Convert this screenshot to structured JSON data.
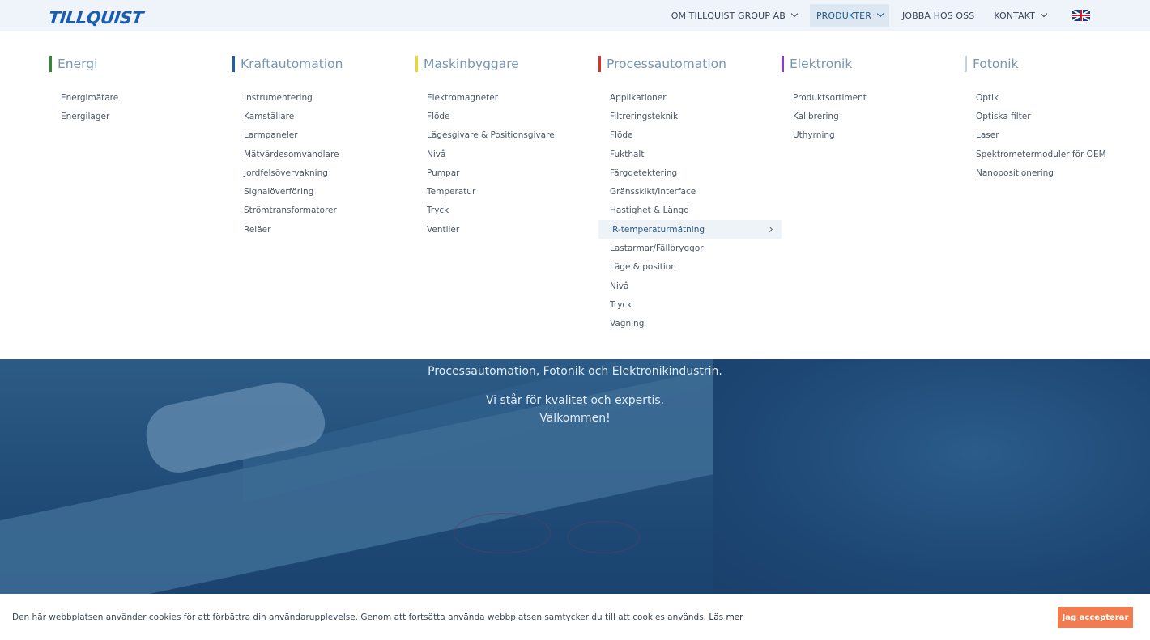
{
  "logo": {
    "text": "TILLQUIST"
  },
  "nav": {
    "items": [
      {
        "label": "OM TILLQUIST GROUP AB",
        "has_dropdown": true,
        "active": false
      },
      {
        "label": "PRODUKTER",
        "has_dropdown": true,
        "active": true
      },
      {
        "label": "JOBBA HOS OSS",
        "has_dropdown": false,
        "active": false
      },
      {
        "label": "KONTAKT",
        "has_dropdown": true,
        "active": false
      }
    ],
    "language_flag": "uk-flag-icon"
  },
  "mega_menu": {
    "columns": [
      {
        "title": "Energi",
        "accent": "#2e8b3a",
        "items": [
          "Energimätare",
          "Energilager"
        ]
      },
      {
        "title": "Kraftautomation",
        "accent": "#1f5fa8",
        "items": [
          "Instrumentering",
          "Kamställare",
          "Larmpaneler",
          "Mätvärdesomvandlare",
          "Jordfelsövervakning",
          "Signalöverföring",
          "Strömtransformatorer",
          "Reläer"
        ]
      },
      {
        "title": "Maskinbyggare",
        "accent": "#f2d42a",
        "items": [
          "Elektromagneter",
          "Flöde",
          "Lägesgivare & Positionsgivare",
          "Nivå",
          "Pumpar",
          "Temperatur",
          "Tryck",
          "Ventiler"
        ]
      },
      {
        "title": "Processautomation",
        "accent": "#d8312b",
        "items": [
          "Applikationer",
          "Filtreringsteknik",
          "Flöde",
          "Fukthalt",
          "Färgdetektering",
          "Gränsskikt/Interface",
          "Hastighet & Längd",
          "IR-temperaturmätning",
          "Lastarmar/Fällbryggor",
          "Läge & position",
          "Nivå",
          "Tryck",
          "Vägning"
        ],
        "highlighted_index": 7
      },
      {
        "title": "Elektronik",
        "accent": "#8a3fc4",
        "items": [
          "Produktsortiment",
          "Kalibrering",
          "Uthyrning"
        ]
      },
      {
        "title": "Fotonik",
        "accent": "#c9d1da",
        "items": [
          "Optik",
          "Optiska filter",
          "Laser",
          "Spektrometermoduler för OEM",
          "Nanopositionering"
        ]
      }
    ]
  },
  "hero": {
    "line1": "Processautomation, Fotonik och Elektronikindustrin.",
    "line2": "Vi står för kvalitet och expertis.",
    "line3": "Välkommen!"
  },
  "cookie": {
    "text": "Den här webbplatsen använder cookies för att förbättra din användarupplevelse. Genom att fortsätta använda webbplatsen samtycker du till att cookies används.",
    "more_label": "Läs mer",
    "accept_label": "Jag accepterar",
    "accept_color": "#f07c50"
  }
}
